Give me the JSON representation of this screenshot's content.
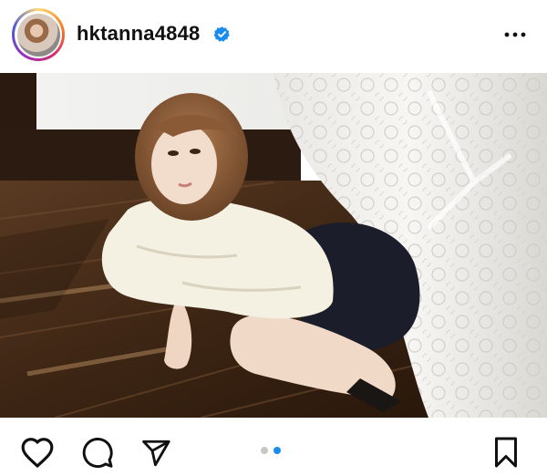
{
  "post": {
    "username": "hktanna4848",
    "verified_icon": "verified-badge-icon",
    "more_icon": "more-options-icon",
    "photo_alt": "photo",
    "carousel": {
      "total": 2,
      "active": 2
    }
  },
  "actions": {
    "like_icon": "heart-icon",
    "comment_icon": "comment-icon",
    "share_icon": "send-icon",
    "save_icon": "bookmark-icon"
  },
  "colors": {
    "verified": "#1a8cf0",
    "dot_active": "#1a8cf0",
    "dot_inactive": "#c7c7c7"
  }
}
